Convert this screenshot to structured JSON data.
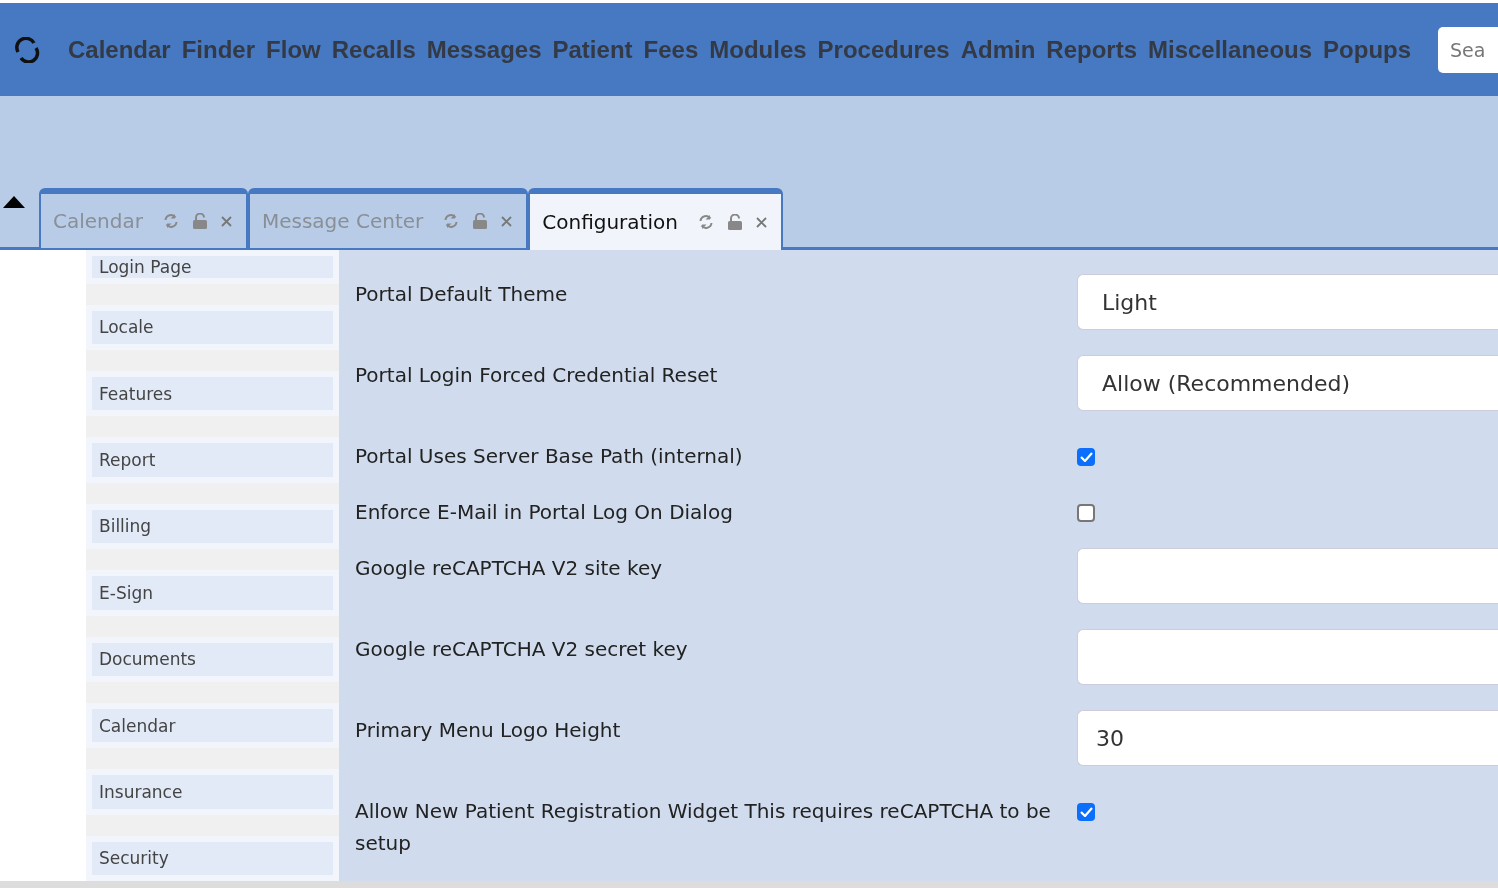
{
  "menu": [
    "Calendar",
    "Finder",
    "Flow",
    "Recalls",
    "Messages",
    "Patient",
    "Fees",
    "Modules",
    "Procedures",
    "Admin",
    "Reports",
    "Miscellaneous",
    "Popups"
  ],
  "search": {
    "placeholder": "Sea"
  },
  "tabs": [
    {
      "label": "Calendar",
      "selected": false
    },
    {
      "label": "Message Center",
      "selected": false
    },
    {
      "label": "Configuration",
      "selected": true
    }
  ],
  "sidebar": {
    "items": [
      "Login Page",
      "Locale",
      "Features",
      "Report",
      "Billing",
      "E-Sign",
      "Documents",
      "Calendar",
      "Insurance",
      "Security"
    ]
  },
  "settings": [
    {
      "label": "Portal Default Theme",
      "kind": "select",
      "value": "Light"
    },
    {
      "label": "Portal Login Forced Credential Reset",
      "kind": "select",
      "value": "Allow (Recommended)"
    },
    {
      "label": "Portal Uses Server Base Path (internal)",
      "kind": "checkbox",
      "checked": true
    },
    {
      "label": "Enforce E-Mail in Portal Log On Dialog",
      "kind": "checkbox",
      "checked": false
    },
    {
      "label": "Google reCAPTCHA V2 site key",
      "kind": "text"
    },
    {
      "label": "Google reCAPTCHA V2 secret key",
      "kind": "text"
    },
    {
      "label": "Primary Menu Logo Height",
      "kind": "text",
      "value": "30"
    },
    {
      "label": "Allow New Patient Registration Widget This requires reCAPTCHA to be setup",
      "kind": "checkbox",
      "checked": true
    }
  ]
}
